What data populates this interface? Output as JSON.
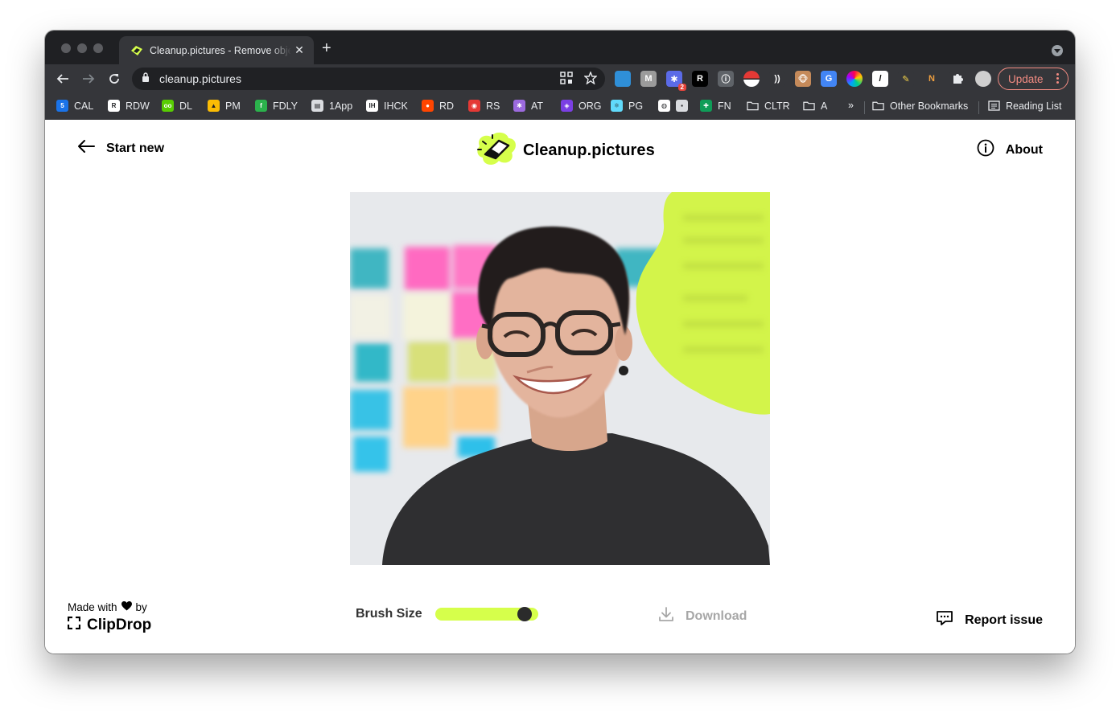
{
  "browser": {
    "tab": {
      "title": "Cleanup.pictures - Remove objects"
    },
    "address": {
      "url": "cleanup.pictures"
    },
    "update_label": "Update",
    "extensions": [
      {
        "icon": "gem-extension-icon",
        "color": "#2f8fd8",
        "label": ""
      },
      {
        "icon": "m-extension-icon",
        "color": "#9b9b9b",
        "label": "M"
      },
      {
        "icon": "snowflake-extension-icon",
        "color": "#5b6be8",
        "label": "✱",
        "badge": "2"
      },
      {
        "icon": "r-extension-icon",
        "color": "#000000",
        "label": "R"
      },
      {
        "icon": "info-extension-icon",
        "color": "#5f6368",
        "label": "ⓘ"
      },
      {
        "icon": "pokeball-extension-icon",
        "color": "#e53935",
        "label": ""
      },
      {
        "icon": "signal-extension-icon",
        "color": "#35363a",
        "label": "))"
      },
      {
        "icon": "monkey-extension-icon",
        "color": "#c58a5a",
        "label": "🐵"
      },
      {
        "icon": "translate-extension-icon",
        "color": "#4285f4",
        "label": "G"
      },
      {
        "icon": "color-ring-extension-icon",
        "color": "#ffffff",
        "label": ""
      },
      {
        "icon": "slash-extension-icon",
        "color": "#ffffff",
        "label": "/"
      },
      {
        "icon": "highlighter-extension-icon",
        "color": "#35363a",
        "label": "✎"
      },
      {
        "icon": "ni-extension-icon",
        "color": "#35363a",
        "label": "N"
      },
      {
        "icon": "puzzle-extension-icon",
        "color": "#35363a",
        "label": ""
      },
      {
        "icon": "profile-avatar-icon",
        "color": "#cfcfcf",
        "label": ""
      }
    ],
    "bookmarks": [
      {
        "label": "CAL",
        "icon": "calendar-icon",
        "color": "#1a73e8",
        "glyph": "5"
      },
      {
        "label": "RDW",
        "icon": "r-icon",
        "color": "#ffffff",
        "glyph": "R"
      },
      {
        "label": "DL",
        "icon": "duolingo-icon",
        "color": "#58cc02",
        "glyph": "oo"
      },
      {
        "label": "PM",
        "icon": "drive-icon",
        "color": "#fbbc04",
        "glyph": "▲"
      },
      {
        "label": "FDLY",
        "icon": "feedly-icon",
        "color": "#2bb24c",
        "glyph": "f"
      },
      {
        "label": "1App",
        "icon": "onapp-icon",
        "color": "#dadce0",
        "glyph": "▤"
      },
      {
        "label": "IHCK",
        "icon": "ihck-icon",
        "color": "#ffffff",
        "glyph": "IH"
      },
      {
        "label": "RD",
        "icon": "reddit-icon",
        "color": "#ff4500",
        "glyph": "●"
      },
      {
        "label": "RS",
        "icon": "rs-icon",
        "color": "#e53935",
        "glyph": "◉"
      },
      {
        "label": "AT",
        "icon": "asterisk-icon",
        "color": "#9c6ade",
        "glyph": "✱"
      },
      {
        "label": "ORG",
        "icon": "shield-icon",
        "color": "#7b3fe4",
        "glyph": "◈"
      },
      {
        "label": "PG",
        "icon": "react-icon",
        "color": "#61dafb",
        "glyph": "⚛"
      },
      {
        "label": "",
        "icon": "globe-icon",
        "color": "#ffffff",
        "glyph": "◍"
      },
      {
        "label": "",
        "icon": "note-icon",
        "color": "#dadce0",
        "glyph": "▪"
      },
      {
        "label": "FN",
        "icon": "plus-icon",
        "color": "#0f9d58",
        "glyph": "✚"
      },
      {
        "label": "CLTR",
        "icon": "folder-icon",
        "color": "",
        "glyph": ""
      },
      {
        "label": "A",
        "icon": "folder-icon",
        "color": "",
        "glyph": ""
      }
    ],
    "overflow_label": "»",
    "other_bookmarks_label": "Other Bookmarks",
    "reading_list_label": "Reading List"
  },
  "app": {
    "start_new_label": "Start new",
    "logo_text": "Cleanup.pictures",
    "about_label": "About",
    "made_with_prefix": "Made with",
    "made_with_suffix": "by",
    "clipdrop_label": "ClipDrop",
    "brush_size_label": "Brush Size",
    "brush_size_value": 0.93,
    "download_label": "Download",
    "report_issue_label": "Report issue",
    "accent_color": "#d6ff4b"
  }
}
